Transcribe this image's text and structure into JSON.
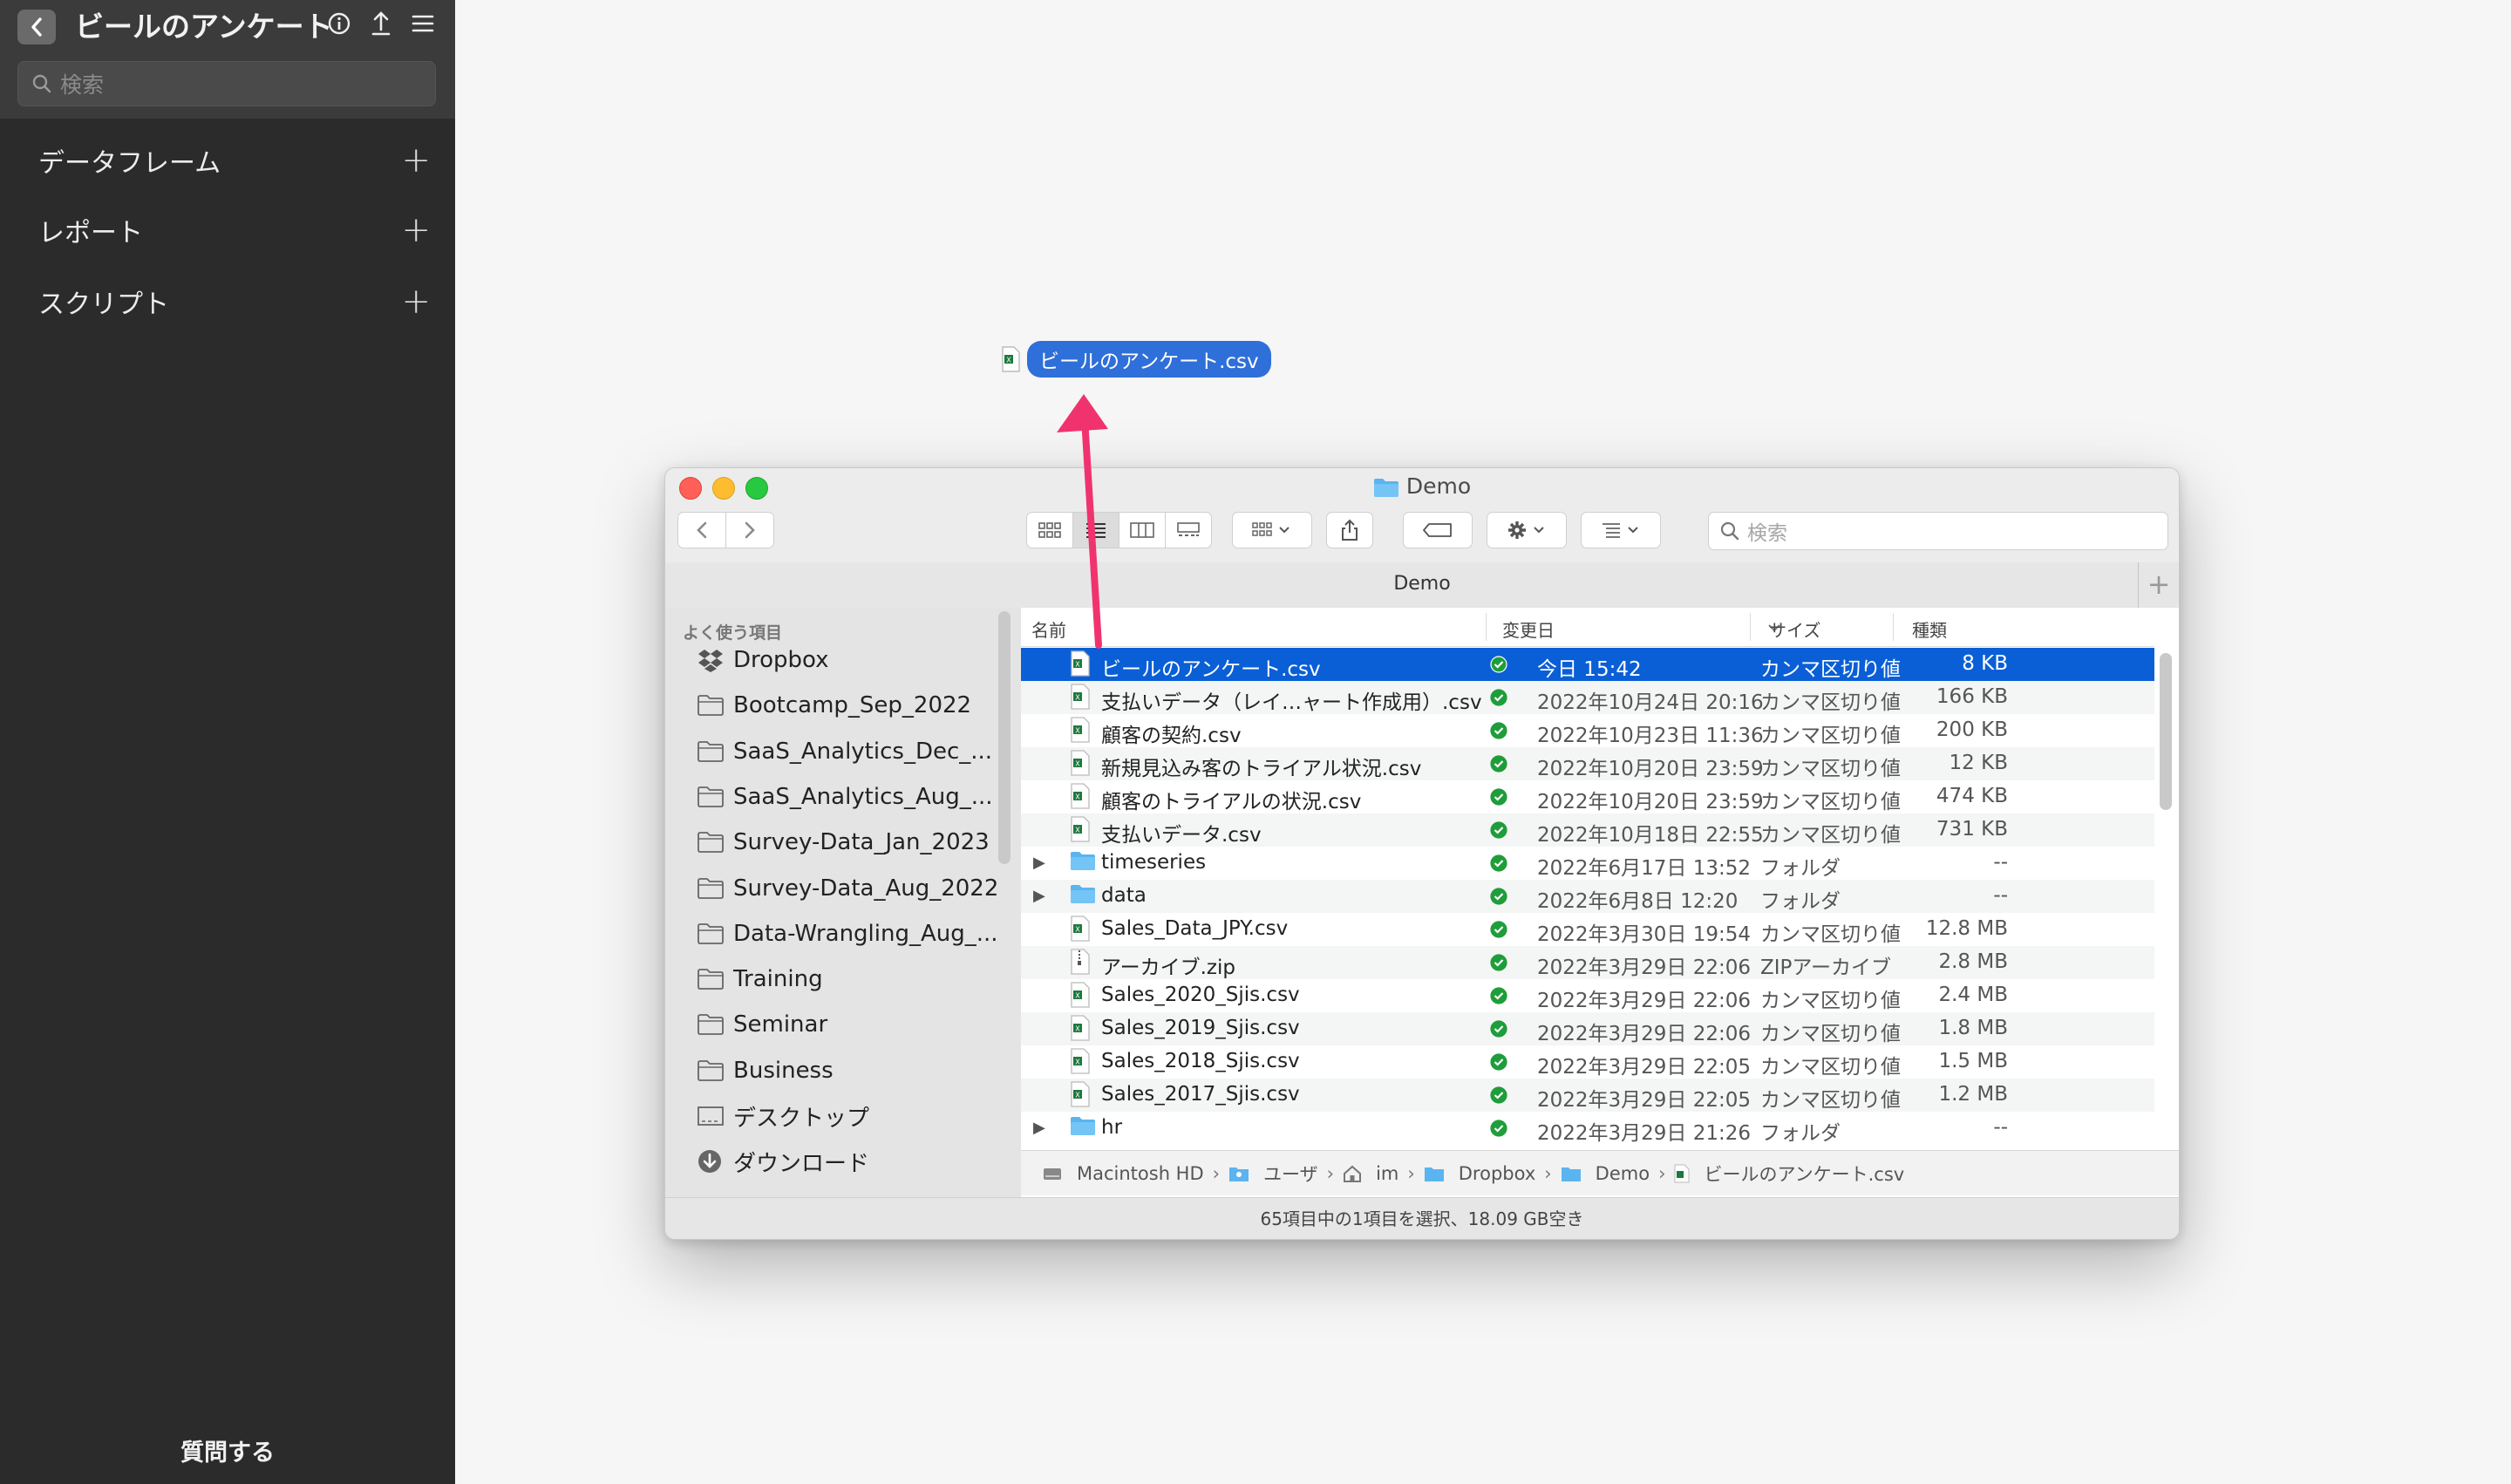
{
  "app": {
    "title": "ビールのアンケート",
    "search_placeholder": "検索",
    "sections": [
      "データフレーム",
      "レポート",
      "スクリプト"
    ],
    "ask_button": "質問する"
  },
  "drag": {
    "label": "ビールのアンケート.csv"
  },
  "finder": {
    "window_title": "Demo",
    "tab_label": "Demo",
    "search_placeholder": "検索",
    "sidebar": {
      "section": "よく使う項目",
      "items": [
        {
          "label": "Dropbox",
          "icon": "dropbox-icon"
        },
        {
          "label": "Bootcamp_Sep_2022",
          "icon": "folder-icon"
        },
        {
          "label": "SaaS_Analytics_Dec_...",
          "icon": "folder-icon"
        },
        {
          "label": "SaaS_Analytics_Aug_...",
          "icon": "folder-icon"
        },
        {
          "label": "Survey-Data_Jan_2023",
          "icon": "folder-icon"
        },
        {
          "label": "Survey-Data_Aug_2022",
          "icon": "folder-icon"
        },
        {
          "label": "Data-Wrangling_Aug_...",
          "icon": "folder-icon"
        },
        {
          "label": "Training",
          "icon": "folder-icon"
        },
        {
          "label": "Seminar",
          "icon": "folder-icon"
        },
        {
          "label": "Business",
          "icon": "folder-icon"
        },
        {
          "label": "デスクトップ",
          "icon": "desktop-icon"
        },
        {
          "label": "ダウンロード",
          "icon": "download-icon"
        }
      ]
    },
    "columns": {
      "name": "名前",
      "date": "変更日",
      "size": "サイズ",
      "kind": "種類"
    },
    "files": [
      {
        "name": "ビールのアンケート.csv",
        "date": "今日 15:42",
        "size": "8 KB",
        "kind": "カンマ区切り値",
        "type": "csv",
        "selected": true
      },
      {
        "name": "支払いデータ（レイ…ャート作成用）.csv",
        "date": "2022年10月24日 20:16",
        "size": "166 KB",
        "kind": "カンマ区切り値",
        "type": "csv"
      },
      {
        "name": "顧客の契約.csv",
        "date": "2022年10月23日 11:36",
        "size": "200 KB",
        "kind": "カンマ区切り値",
        "type": "csv"
      },
      {
        "name": "新規見込み客のトライアル状況.csv",
        "date": "2022年10月20日 23:59",
        "size": "12 KB",
        "kind": "カンマ区切り値",
        "type": "csv"
      },
      {
        "name": "顧客のトライアルの状況.csv",
        "date": "2022年10月20日 23:59",
        "size": "474 KB",
        "kind": "カンマ区切り値",
        "type": "csv"
      },
      {
        "name": "支払いデータ.csv",
        "date": "2022年10月18日 22:55",
        "size": "731 KB",
        "kind": "カンマ区切り値",
        "type": "csv"
      },
      {
        "name": "timeseries",
        "date": "2022年6月17日 13:52",
        "size": "--",
        "kind": "フォルダ",
        "type": "folder"
      },
      {
        "name": "data",
        "date": "2022年6月8日 12:20",
        "size": "--",
        "kind": "フォルダ",
        "type": "folder"
      },
      {
        "name": "Sales_Data_JPY.csv",
        "date": "2022年3月30日 19:54",
        "size": "12.8 MB",
        "kind": "カンマ区切り値",
        "type": "csv"
      },
      {
        "name": "アーカイブ.zip",
        "date": "2022年3月29日 22:06",
        "size": "2.8 MB",
        "kind": "ZIPアーカイブ",
        "type": "zip"
      },
      {
        "name": "Sales_2020_Sjis.csv",
        "date": "2022年3月29日 22:06",
        "size": "2.4 MB",
        "kind": "カンマ区切り値",
        "type": "csv"
      },
      {
        "name": "Sales_2019_Sjis.csv",
        "date": "2022年3月29日 22:06",
        "size": "1.8 MB",
        "kind": "カンマ区切り値",
        "type": "csv"
      },
      {
        "name": "Sales_2018_Sjis.csv",
        "date": "2022年3月29日 22:05",
        "size": "1.5 MB",
        "kind": "カンマ区切り値",
        "type": "csv"
      },
      {
        "name": "Sales_2017_Sjis.csv",
        "date": "2022年3月29日 22:05",
        "size": "1.2 MB",
        "kind": "カンマ区切り値",
        "type": "csv"
      },
      {
        "name": "hr",
        "date": "2022年3月29日 21:26",
        "size": "--",
        "kind": "フォルダ",
        "type": "folder"
      }
    ],
    "path": [
      "Macintosh HD",
      "ユーザ",
      "im",
      "Dropbox",
      "Demo",
      "ビールのアンケート.csv"
    ],
    "status": "65項目中の1項目を選択、18.09 GB空き"
  },
  "colors": {
    "selection": "#0a5fd6",
    "accent_arrow": "#f0336f",
    "sync_check": "#1f9d3b"
  }
}
